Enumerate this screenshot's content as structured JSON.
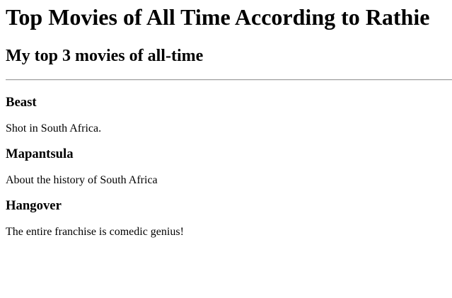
{
  "page": {
    "title": "Top Movies of All Time According to Rathie",
    "subtitle": "My top 3 movies of all-time"
  },
  "movies": [
    {
      "title": "Beast",
      "description": "Shot in South Africa."
    },
    {
      "title": "Mapantsula",
      "description": "About the history of South Africa"
    },
    {
      "title": "Hangover",
      "description": "The entire franchise is comedic genius!"
    }
  ]
}
